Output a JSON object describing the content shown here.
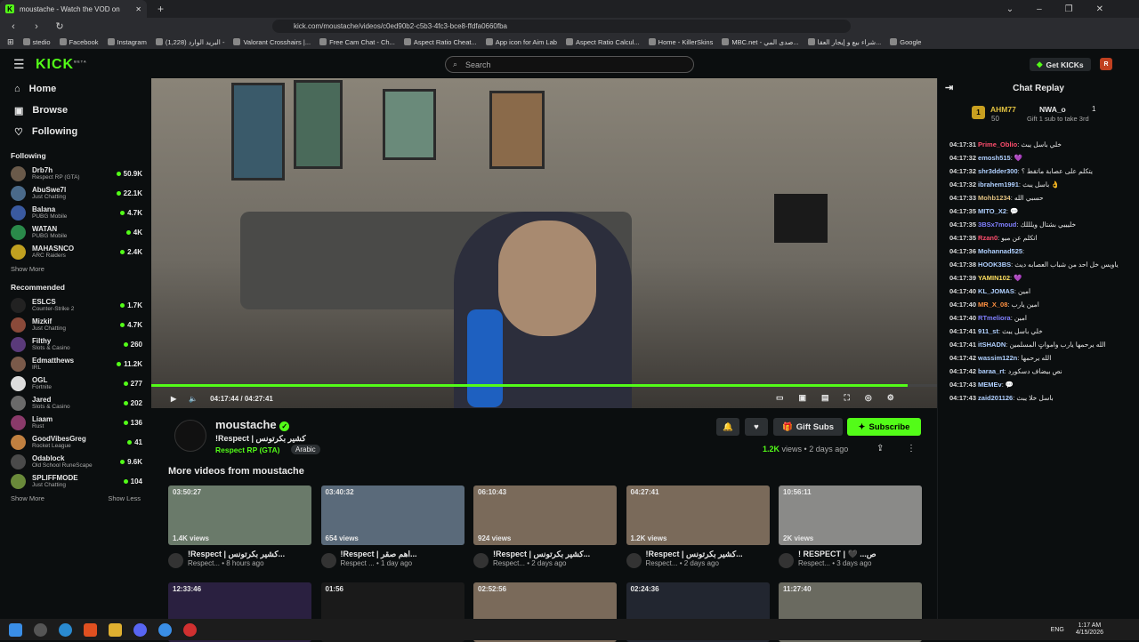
{
  "browser": {
    "tab_title": "moustache - Watch the VOD on",
    "tab_close": "✕",
    "tab_new": "+",
    "url": "kick.com/moustache/videos/c0ed90b2-c5b3-4fc3-bce8-ffdfa0660fba",
    "bookmarks": [
      "stedio",
      "Facebook",
      "Instagram",
      "(1,228) البريد الوارد -",
      "Valorant Crosshairs |...",
      "Free Cam Chat - Ch...",
      "Aspect Ratio Cheat...",
      "App icon for Aim Lab",
      "Aspect Ratio Calcul...",
      "Home - KillerSkins",
      "MBC.net - صدى المي...",
      "شراء بيع و إيجار العقا...",
      "Google"
    ]
  },
  "header": {
    "logo": "KICK",
    "logo_sup": "BETA",
    "search_placeholder": "Search",
    "get_kicks": "Get KICKs"
  },
  "sidebar": {
    "nav": [
      {
        "label": "Home",
        "icon": "⌂"
      },
      {
        "label": "Browse",
        "icon": "▣"
      },
      {
        "label": "Following",
        "icon": "♡"
      }
    ],
    "following_title": "Following",
    "following": [
      {
        "name": "Drb7h",
        "cat": "Respect RP (GTA)",
        "viewers": "50.9K",
        "color": "#6a5a4a"
      },
      {
        "name": "AbuSwe7l",
        "cat": "Just Chatting",
        "viewers": "22.1K",
        "color": "#4a6a8a"
      },
      {
        "name": "Balana",
        "cat": "PUBG Mobile",
        "viewers": "4.7K",
        "color": "#3a5aa0"
      },
      {
        "name": "WATAN",
        "cat": "PUBG Mobile",
        "viewers": "4K",
        "color": "#2a8a4a"
      },
      {
        "name": "MAHASNCO",
        "cat": "ARC Raiders",
        "viewers": "2.4K",
        "color": "#c0a020"
      }
    ],
    "show_more": "Show More",
    "recommended_title": "Recommended",
    "recommended": [
      {
        "name": "ESLCS",
        "cat": "Counter-Strike 2",
        "viewers": "1.7K",
        "color": "#222"
      },
      {
        "name": "Mizkif",
        "cat": "Just Chatting",
        "viewers": "4.7K",
        "color": "#8a4a3a"
      },
      {
        "name": "Filthy",
        "cat": "Slots & Casino",
        "viewers": "260",
        "color": "#5a3a7a"
      },
      {
        "name": "Edmatthews",
        "cat": "IRL",
        "viewers": "11.2K",
        "color": "#7a5a4a"
      },
      {
        "name": "OGL",
        "cat": "Fortnite",
        "viewers": "277",
        "color": "#ddd"
      },
      {
        "name": "Jared",
        "cat": "Slots & Casino",
        "viewers": "202",
        "color": "#6a6a6a"
      },
      {
        "name": "Liaam",
        "cat": "Rust",
        "viewers": "136",
        "color": "#8a3a6a"
      },
      {
        "name": "GoodVibesGreg",
        "cat": "Rocket League",
        "viewers": "41",
        "color": "#c08040"
      },
      {
        "name": "Odablock",
        "cat": "Old School RuneScape",
        "viewers": "9.6K",
        "color": "#4a4a4a"
      },
      {
        "name": "SPLIFFMODE",
        "cat": "Just Chatting",
        "viewers": "104",
        "color": "#6a8a3a"
      }
    ],
    "show_more2": "Show More",
    "show_less": "Show Less"
  },
  "player": {
    "time": "04:17:44 / 04:27:41",
    "progress": 0.963
  },
  "channel": {
    "name": "moustache",
    "title": "!Respect | كشير بكرتونس",
    "category": "Respect RP (GTA)",
    "language": "Arabic",
    "views": "1.2K",
    "views_label": "views",
    "date": "2 days ago",
    "gift_subs": "Gift Subs",
    "subscribe": "Subscribe"
  },
  "more_videos_title": "More videos from moustache",
  "videos": [
    {
      "dur": "03:50:27",
      "views": "1.4K views",
      "title": "!Respect | كشير بكرتونس...",
      "sub": "Respect... • 8 hours ago",
      "color": "#6a7a6a"
    },
    {
      "dur": "03:40:32",
      "views": "654 views",
      "title": "!Respect | اهم صقر...",
      "sub": "Respect ... • 1 day ago",
      "color": "#5a6a7a"
    },
    {
      "dur": "06:10:43",
      "views": "924 views",
      "title": "!Respect | كشير بكرتونس...",
      "sub": "Respect... • 2 days ago",
      "color": "#7a6a5a"
    },
    {
      "dur": "04:27:41",
      "views": "1.2K views",
      "title": "!Respect | كشير بكرتونس...",
      "sub": "Respect... • 2 days ago",
      "color": "#7a6a5a"
    },
    {
      "dur": "10:56:11",
      "views": "2K views",
      "title": "! RESPECT | 🖤 ...ص",
      "sub": "Respect... • 3 days ago",
      "color": "#8a8a88"
    },
    {
      "dur": "12:33:46",
      "color": "#2a2040"
    },
    {
      "dur": "01:56",
      "color": "#1a1a1a"
    },
    {
      "dur": "02:52:56",
      "color": "#7a6a5a"
    },
    {
      "dur": "02:24:36",
      "color": "#222630"
    },
    {
      "dur": "11:27:40",
      "color": "#6a6a60"
    }
  ],
  "chat": {
    "title": "Chat Replay",
    "top1": {
      "name": "AHM77",
      "count": "50"
    },
    "top2": {
      "name": "NWA_o",
      "count": "1",
      "sub": "Gift 1 sub to take 3rd"
    },
    "messages": [
      {
        "t": "04:17:31",
        "u": "Prime_Oblio",
        "c": "#ff4d6d",
        "m": "خلي باسل يبث"
      },
      {
        "t": "04:17:32",
        "u": "emosh515",
        "c": "#b0d0ff",
        "m": "💜"
      },
      {
        "t": "04:17:32",
        "u": "shr3dder300",
        "c": "#b0d0ff",
        "m": "يتكلم على عصابة ماتقط ؟"
      },
      {
        "t": "04:17:32",
        "u": "ibrahem1991",
        "c": "#b0d0ff",
        "m": "باسل يبث 👌"
      },
      {
        "t": "04:17:33",
        "u": "Mohb1234",
        "c": "#e0c080",
        "m": "حسبي الله"
      },
      {
        "t": "04:17:35",
        "u": "MITO_X2",
        "c": "#b0d0ff",
        "m": "💬"
      },
      {
        "t": "04:17:35",
        "u": "3BSx7moud",
        "c": "#8080ff",
        "m": "خليييي بشتال ويلللك"
      },
      {
        "t": "04:17:35",
        "u": "Rzan0",
        "c": "#ff4d6d",
        "m": "اتكلم عن ميو"
      },
      {
        "t": "04:17:36",
        "u": "Mohannad525",
        "c": "#b0d0ff",
        "m": ""
      },
      {
        "t": "04:17:38",
        "u": "HOOK3BS",
        "c": "#b0d0ff",
        "m": "ياويس خل احد من شباب العصابه ديث"
      },
      {
        "t": "04:17:39",
        "u": "YAMIN102",
        "c": "#ffe060",
        "m": "💜"
      },
      {
        "t": "04:17:40",
        "u": "KL_JOMAS",
        "c": "#b0d0ff",
        "m": "امين"
      },
      {
        "t": "04:17:40",
        "u": "MR_X_08",
        "c": "#ff9040",
        "m": "امين يارب"
      },
      {
        "t": "04:17:40",
        "u": "RTmeliora",
        "c": "#8080ff",
        "m": "امين"
      },
      {
        "t": "04:17:41",
        "u": "911_st",
        "c": "#b0d0ff",
        "m": "خلي باسل يبث"
      },
      {
        "t": "04:17:41",
        "u": "itSHADN",
        "c": "#b0d0ff",
        "m": "الله يرحمها يارب وامواتٍ المسلمين"
      },
      {
        "t": "04:17:42",
        "u": "wassim122n",
        "c": "#b0d0ff",
        "m": "الله يرحمها"
      },
      {
        "t": "04:17:42",
        "u": "baraa_rt",
        "c": "#b0d0ff",
        "m": "نص بيضاف دسكورد"
      },
      {
        "t": "04:17:43",
        "u": "MEMEv",
        "c": "#b0d0ff",
        "m": "💬"
      },
      {
        "t": "04:17:43",
        "u": "zaid201126",
        "c": "#b0d0ff",
        "m": "باسل خلا يبث"
      }
    ]
  },
  "taskbar": {
    "lang": "ENG",
    "time": "1:17 AM",
    "date": "4/15/2026"
  },
  "colors": {
    "accent": "#53fc18"
  }
}
